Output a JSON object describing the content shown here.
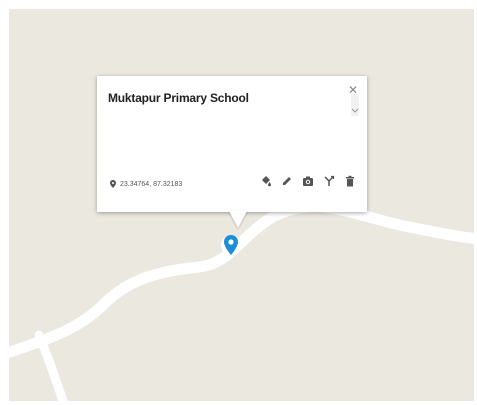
{
  "place": {
    "name": "Muktapur Primary School",
    "coordinates": "23.34764, 87.32183"
  },
  "icons": {
    "close": "close-icon",
    "location": "location-pin-icon",
    "style": "paint-bucket-icon",
    "edit": "pencil-icon",
    "photo": "camera-icon",
    "directions": "directions-icon",
    "delete": "trash-icon",
    "marker": "map-marker-icon"
  },
  "colors": {
    "marker": "#1a8fd6",
    "map_land": "#ebe8e0",
    "road": "#ffffff"
  }
}
